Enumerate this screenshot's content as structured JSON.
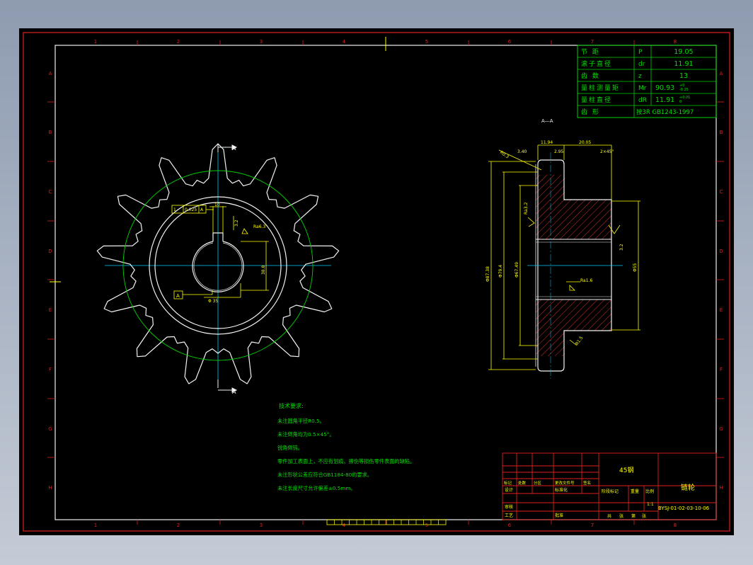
{
  "zone_numbers_top": [
    "1",
    "2",
    "3",
    "4",
    "5",
    "6",
    "7",
    "8"
  ],
  "zone_numbers_bottom": [
    "1",
    "2",
    "3",
    "4",
    "5",
    "6",
    "7",
    "8"
  ],
  "zone_letters_left": [
    "A",
    "B",
    "C",
    "D",
    "E",
    "F",
    "G",
    "H"
  ],
  "zone_letters_right": [
    "A",
    "B",
    "C",
    "D",
    "E",
    "F",
    "G",
    "H"
  ],
  "param_table": [
    {
      "name": "节  距",
      "symbol": "P",
      "value": "19.05"
    },
    {
      "name": "滚子直径",
      "symbol": "dr",
      "value": "11.91"
    },
    {
      "name": "齿  数",
      "symbol": "z",
      "value": "13"
    },
    {
      "name": "量柱测量矩",
      "symbol": "Mr",
      "value": "90.93",
      "tol_upper": "+0",
      "tol_lower": "-0.25"
    },
    {
      "name": "量柱直径",
      "symbol": "dR",
      "value": "11.91",
      "tol_upper": "+0.01",
      "tol_lower": "0"
    },
    {
      "name": "齿  形",
      "symbol": "",
      "value": "按3R  GB1243-1997"
    }
  ],
  "front_view": {
    "section_mark": "A",
    "keyway_label": "A",
    "dim_keyway_width": "10",
    "dim_keyway_depth": "38.8",
    "dim_bore": "Φ 35",
    "roughness_keyway": "Ra6.3",
    "roughness_side": "3.2",
    "datum_frame": [
      "1",
      "0.025",
      "A"
    ]
  },
  "section_view": {
    "title": "A—A",
    "dim_tooth_width": "11.94",
    "dim_hub_len": "20.05",
    "dim_chamfer_tooth": "3.40",
    "dim_gap": "2.95",
    "dim_chamfer_hub": "2×45°",
    "dim_angle": "R0.3",
    "dim_od": "Φ87.38",
    "dim_pitch": "Φ79.4",
    "dim_root": "Φ67.49",
    "dim_hub": "Φ55",
    "roughness_bore": "Ra1.6",
    "roughness_a": "Ra3.2",
    "roughness_b": "3.2",
    "dim_r": "R1.5"
  },
  "tech_requirements": {
    "heading": "技术要求:",
    "items": [
      "未注圆角半径R0.5。",
      "未注倒角均为0.5×45°。",
      "锐角倒钝。",
      "零件加工表面上，不应有划痕、擦伤等损伤零件表面的缺陷。",
      "未注形状公差应符合GB1184-80的要求。",
      "未注长度尺寸允许偏差±0.5mm。"
    ]
  },
  "title_block": {
    "material": "45钢",
    "part_name": "链轮",
    "drawing_no": "BYSJ-01-02-03-10-06",
    "scale": "1:1",
    "row_headers": [
      "标记",
      "处数",
      "分区",
      "更改文件号",
      "签名",
      "日期"
    ],
    "design_row": [
      "设计",
      "",
      "标准化",
      ""
    ],
    "stage_headers": [
      "阶段标记",
      "重量",
      "比例"
    ],
    "sheet_row": [
      "共",
      "张",
      "第",
      "张"
    ],
    "check_label": "审核",
    "process_label": "工艺",
    "approve_label": "批准"
  }
}
